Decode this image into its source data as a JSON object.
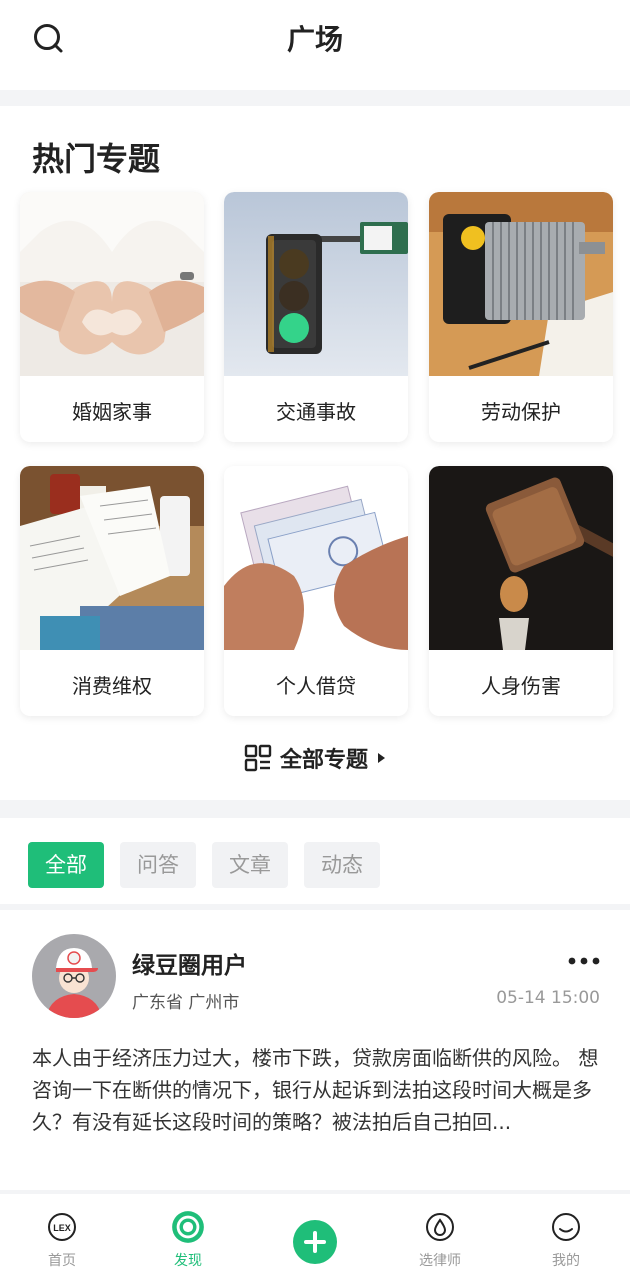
{
  "header": {
    "title": "广场",
    "search_icon": "search-icon"
  },
  "topics": {
    "heading": "热门专题",
    "cards": [
      {
        "label": "婚姻家事"
      },
      {
        "label": "交通事故"
      },
      {
        "label": "劳动保护"
      },
      {
        "label": "消费维权"
      },
      {
        "label": "个人借贷"
      },
      {
        "label": "人身伤害"
      }
    ],
    "all_label": "全部专题"
  },
  "feed": {
    "tabs": [
      {
        "label": "全部",
        "active": true
      },
      {
        "label": "问答",
        "active": false
      },
      {
        "label": "文章",
        "active": false
      },
      {
        "label": "动态",
        "active": false
      }
    ]
  },
  "post": {
    "username": "绿豆圈用户",
    "location": "广东省 广州市",
    "time": "05-14 15:00",
    "body": "本人由于经济压力过大，楼市下跌，贷款房面临断供的风险。 想咨询一下在断供的情况下，银行从起诉到法拍这段时间大概是多久？有没有延长这段时间的策略？被法拍后自己拍回..."
  },
  "bottom_nav": {
    "items": [
      {
        "label": "首页",
        "icon": "lex-home-icon"
      },
      {
        "label": "发现",
        "icon": "discover-icon",
        "active": true
      },
      {
        "label": "",
        "icon": "plus-icon"
      },
      {
        "label": "选律师",
        "icon": "drop-icon"
      },
      {
        "label": "我的",
        "icon": "smile-icon"
      }
    ]
  },
  "colors": {
    "accent": "#1fbe79"
  }
}
